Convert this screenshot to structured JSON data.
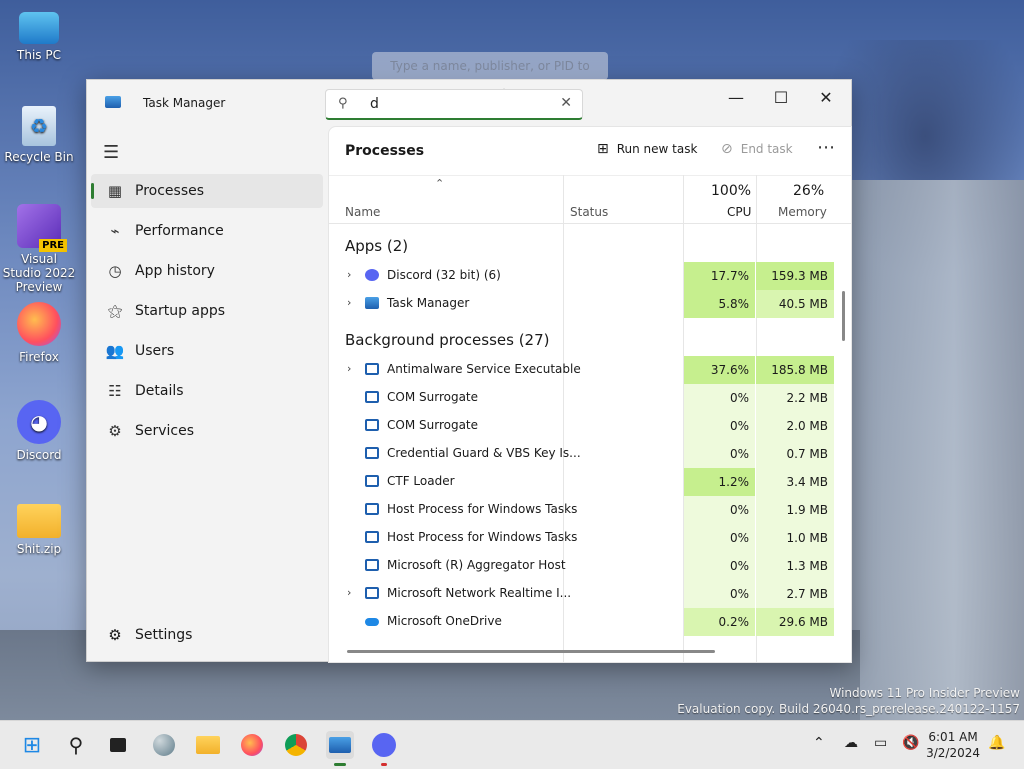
{
  "desktop": {
    "icons": [
      {
        "label": "This PC"
      },
      {
        "label": "Recycle Bin"
      },
      {
        "label": "Visual Studio 2022 Preview",
        "badge": "PRE"
      },
      {
        "label": "Firefox"
      },
      {
        "label": "Discord"
      },
      {
        "label": "Shit.zip"
      }
    ]
  },
  "window": {
    "title": "Task Manager",
    "search": {
      "value": "d",
      "placeholder": "Type a name, publisher, or PID to search",
      "tooltip": "Type a name, publisher, or PID to search"
    },
    "controls": {
      "minimize": "—",
      "maximize": "☐",
      "close": "✕"
    }
  },
  "sidebar": {
    "items": [
      {
        "label": "Processes"
      },
      {
        "label": "Performance"
      },
      {
        "label": "App history"
      },
      {
        "label": "Startup apps"
      },
      {
        "label": "Users"
      },
      {
        "label": "Details"
      },
      {
        "label": "Services"
      }
    ],
    "settings": "Settings"
  },
  "toolbar": {
    "title": "Processes",
    "run_new_task": "Run new task",
    "end_task": "End task",
    "more": "⋯"
  },
  "table": {
    "headers": {
      "name": "Name",
      "status": "Status",
      "cpu_pct": "100%",
      "cpu": "CPU",
      "mem_pct": "26%",
      "mem": "Memory"
    },
    "apps_group": "Apps (2)",
    "bg_group": "Background processes (27)",
    "apps": [
      {
        "name": "Discord (32 bit) (6)",
        "cpu": "17.7%",
        "mem": "159.3 MB"
      },
      {
        "name": "Task Manager",
        "cpu": "5.8%",
        "mem": "40.5 MB"
      }
    ],
    "background": [
      {
        "name": "Antimalware Service Executable",
        "cpu": "37.6%",
        "mem": "185.8 MB"
      },
      {
        "name": "COM Surrogate",
        "cpu": "0%",
        "mem": "2.2 MB"
      },
      {
        "name": "COM Surrogate",
        "cpu": "0%",
        "mem": "2.0 MB"
      },
      {
        "name": "Credential Guard & VBS Key Is...",
        "cpu": "0%",
        "mem": "0.7 MB"
      },
      {
        "name": "CTF Loader",
        "cpu": "1.2%",
        "mem": "3.4 MB"
      },
      {
        "name": "Host Process for Windows Tasks",
        "cpu": "0%",
        "mem": "1.9 MB"
      },
      {
        "name": "Host Process for Windows Tasks",
        "cpu": "0%",
        "mem": "1.0 MB"
      },
      {
        "name": "Microsoft (R) Aggregator Host",
        "cpu": "0%",
        "mem": "1.3 MB"
      },
      {
        "name": "Microsoft Network Realtime I...",
        "cpu": "0%",
        "mem": "2.7 MB"
      },
      {
        "name": "Microsoft OneDrive",
        "cpu": "0.2%",
        "mem": "29.6 MB"
      }
    ]
  },
  "watermark": {
    "line1": "Windows 11 Pro Insider Preview",
    "line2": "Evaluation copy. Build 26040.rs_prerelease.240122-1157"
  },
  "taskbar": {
    "time": "6:01 AM",
    "date": "3/2/2024"
  },
  "colors": {
    "accent": "#2e7d32",
    "heat_high": "#c6ef8e",
    "heat_mid": "#d9f5b0",
    "heat_low": "#eefadc"
  }
}
